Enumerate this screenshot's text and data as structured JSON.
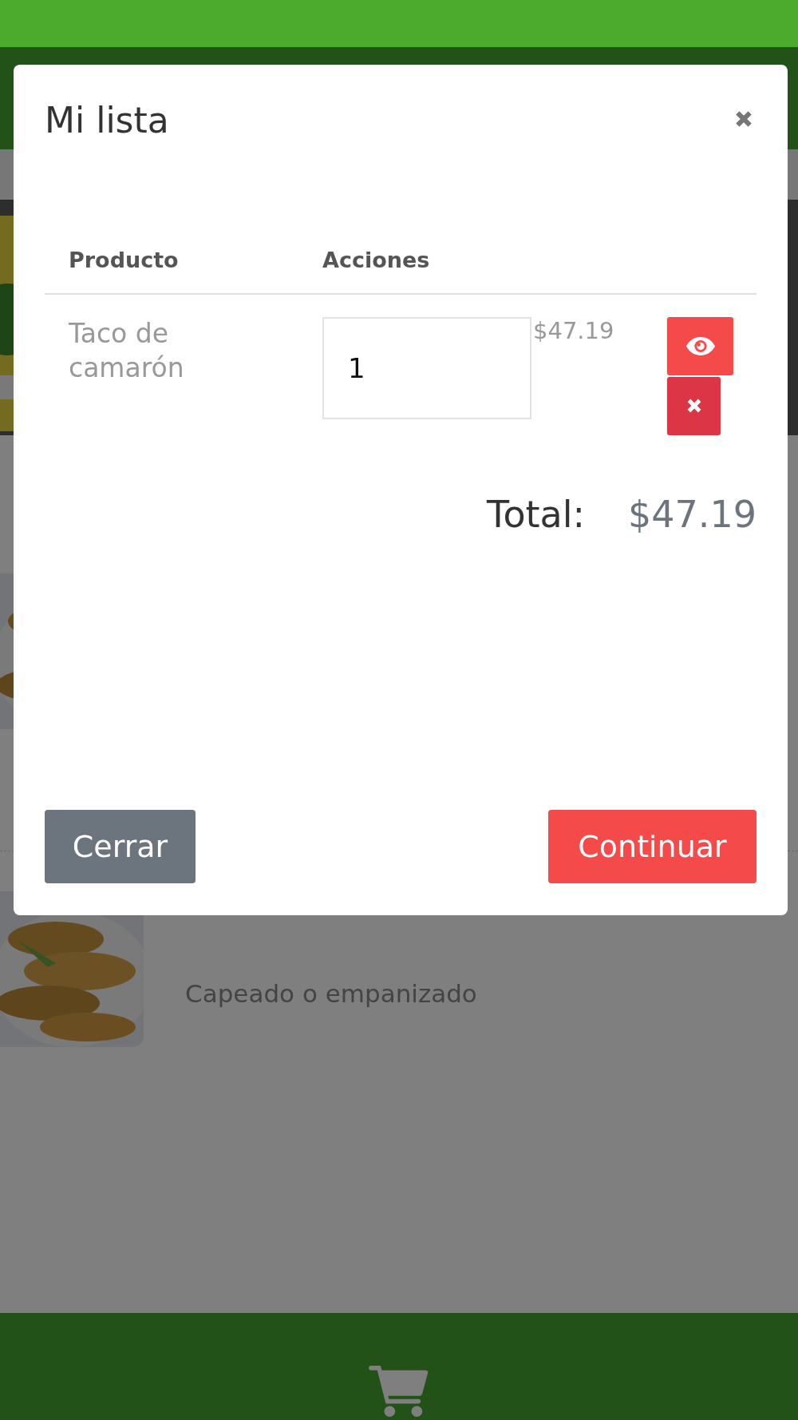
{
  "background": {
    "products": [
      {
        "description": "Capeado o empanizado"
      }
    ]
  },
  "modal": {
    "title": "Mi lista",
    "columns": [
      "Producto",
      "Acciones"
    ],
    "rows": [
      {
        "product": "Taco de camarón",
        "quantity": "1",
        "price": "$47.19"
      }
    ],
    "total_label": "Total:",
    "total": "$47.19",
    "buttons": [
      {
        "label": "Cerrar",
        "kind": "secondary"
      },
      {
        "label": "Continuar",
        "kind": "primary"
      }
    ]
  }
}
